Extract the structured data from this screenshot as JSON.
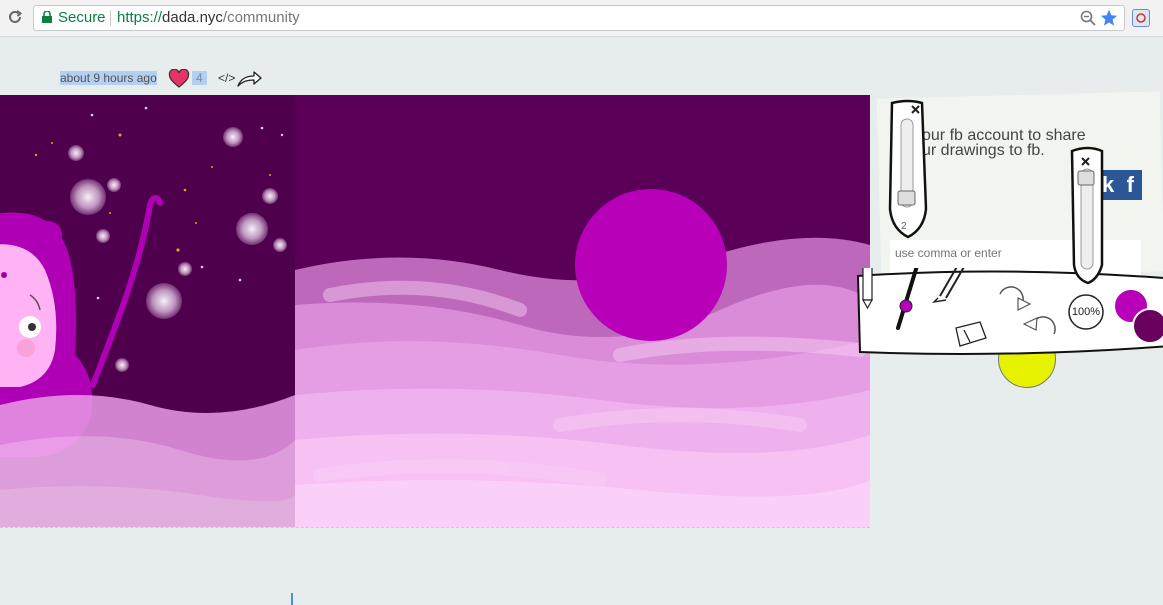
{
  "browser": {
    "secure_label": "Secure",
    "url_scheme": "https://",
    "url_host": "dada.nyc",
    "url_path": "/community"
  },
  "post": {
    "timestamp": "about 9 hours ago",
    "likes": "4",
    "embed_label": "</>"
  },
  "panel": {
    "fb_line1": "our fb account to share",
    "fb_line2": "ur drawings to fb.",
    "fb_button_text": "k",
    "tags_placeholder": "use comma or enter"
  },
  "toolbar": {
    "brush_size_value": "2",
    "zoom_label": "100%",
    "primary_color": "#b800b8",
    "secondary_color": "#6a005e"
  },
  "colors": {
    "canvas_bg": "#5a0058",
    "fb_blue": "#2b5797",
    "heart": "#e8326a"
  }
}
